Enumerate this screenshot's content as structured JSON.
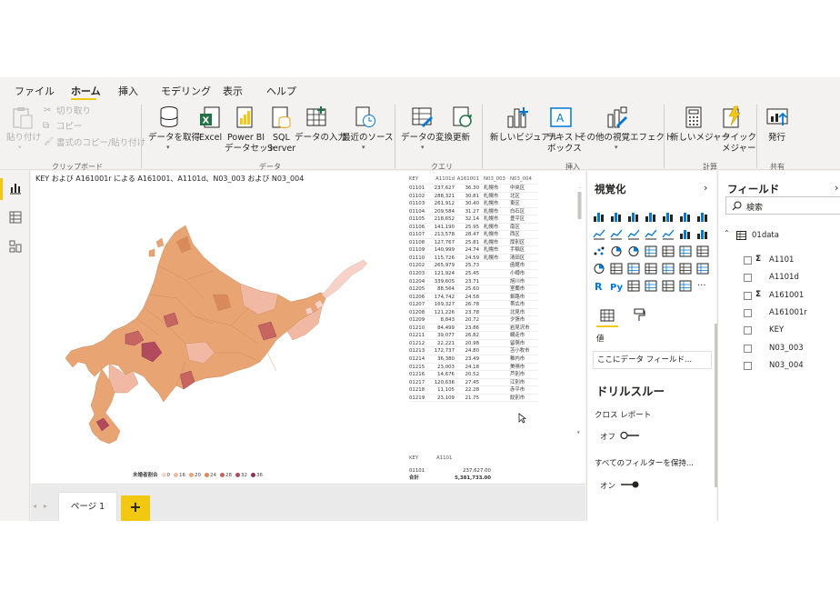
{
  "menu": {
    "file": "ファイル",
    "home": "ホーム",
    "insert": "挿入",
    "modeling": "モデリング",
    "view": "表示",
    "help": "ヘルプ"
  },
  "ribbon": {
    "clipboard": {
      "paste": "貼り付け",
      "cut": "切り取り",
      "copy": "コピー",
      "format_painter": "書式のコピー/貼り付け",
      "group": "クリップボード"
    },
    "data": {
      "get_data": "データを取得",
      "excel": "Excel",
      "pbi_line1": "Power BI",
      "pbi_line2": "データセット",
      "sql_line1": "SQL",
      "sql_line2": "Server",
      "enter_data": "データの入力",
      "recent_sources": "最近のソース",
      "group": "データ"
    },
    "queries": {
      "transform": "データの変換",
      "refresh": "更新",
      "group": "クエリ"
    },
    "insert": {
      "new_visual": "新しいビジュアル",
      "textbox_line1": "テキスト",
      "textbox_line2": "ボックス",
      "more_visuals": "その他の視覚エフェクト",
      "group": "挿入"
    },
    "calc": {
      "new_measure": "新しいメジャー",
      "quick_line1": "クイック",
      "quick_line2": "メジャー",
      "group": "計算"
    },
    "share": {
      "publish": "発行",
      "group": "共有"
    }
  },
  "visual": {
    "title": "KEY および A161001r による A161001、A1101d、N03_003 および N03_004",
    "legend_title": "未婚者割合",
    "legend": [
      {
        "label": "0",
        "color": "#f6d2c9"
      },
      {
        "label": "16",
        "color": "#f1b9a4"
      },
      {
        "label": "20",
        "color": "#e8a473"
      },
      {
        "label": "24",
        "color": "#d98a5a"
      },
      {
        "label": "28",
        "color": "#c76660"
      },
      {
        "label": "32",
        "color": "#b14a5c"
      },
      {
        "label": "36",
        "color": "#8f2f55"
      }
    ]
  },
  "table": {
    "headers": [
      "KEY",
      "A1101d",
      "A161001",
      "N03_003",
      "N03_004"
    ],
    "rows": [
      [
        "01101",
        "237,627",
        "36.30",
        "札幌市",
        "中央区"
      ],
      [
        "01102",
        "288,321",
        "30.81",
        "札幌市",
        "北区"
      ],
      [
        "01103",
        "261,912",
        "30.40",
        "札幌市",
        "東区"
      ],
      [
        "01104",
        "209,584",
        "31.27",
        "札幌市",
        "白石区"
      ],
      [
        "01105",
        "218,652",
        "32.14",
        "札幌市",
        "豊平区"
      ],
      [
        "01106",
        "141,190",
        "25.95",
        "札幌市",
        "南区"
      ],
      [
        "01107",
        "213,578",
        "28.47",
        "札幌市",
        "西区"
      ],
      [
        "01108",
        "127,767",
        "25.81",
        "札幌市",
        "厚別区"
      ],
      [
        "01109",
        "140,999",
        "24.74",
        "札幌市",
        "手稲区"
      ],
      [
        "01110",
        "115,726",
        "24.59",
        "札幌市",
        "清田区"
      ],
      [
        "01202",
        "265,979",
        "25.73",
        "",
        "函館市"
      ],
      [
        "01203",
        "121,924",
        "25.45",
        "",
        "小樽市"
      ],
      [
        "01204",
        "339,605",
        "23.71",
        "",
        "旭川市"
      ],
      [
        "01205",
        "88,564",
        "25.60",
        "",
        "室蘭市"
      ],
      [
        "01206",
        "174,742",
        "24.58",
        "",
        "釧路市"
      ],
      [
        "01207",
        "169,327",
        "26.78",
        "",
        "帯広市"
      ],
      [
        "01208",
        "121,226",
        "23.78",
        "",
        "北見市"
      ],
      [
        "01209",
        "8,843",
        "20.72",
        "",
        "夕張市"
      ],
      [
        "01210",
        "84,499",
        "23.86",
        "",
        "岩見沢市"
      ],
      [
        "01211",
        "39,077",
        "26.82",
        "",
        "網走市"
      ],
      [
        "01212",
        "22,221",
        "20.98",
        "",
        "留萌市"
      ],
      [
        "01213",
        "172,737",
        "24.80",
        "",
        "苫小牧市"
      ],
      [
        "01214",
        "36,380",
        "23.49",
        "",
        "稚内市"
      ],
      [
        "01215",
        "23,003",
        "24.18",
        "",
        "美唄市"
      ],
      [
        "01216",
        "14,676",
        "20.52",
        "",
        "芦別市"
      ],
      [
        "01217",
        "120,636",
        "27.45",
        "",
        "江別市"
      ],
      [
        "01218",
        "11,105",
        "22.28",
        "",
        "赤平市"
      ],
      [
        "01219",
        "23,109",
        "21.75",
        "",
        "紋別市"
      ]
    ],
    "total_table": {
      "headers": [
        "KEY",
        "A1101"
      ],
      "row": [
        "01101",
        "237,627.00"
      ],
      "total": [
        "合計",
        "5,381,733.00"
      ]
    }
  },
  "page_tab": "ページ 1",
  "add_page": "+",
  "viz_pane": {
    "title": "視覚化",
    "values_label": "値",
    "drop_placeholder": "ここにデータ フィールド...",
    "drillthrough": "ドリルスルー",
    "cross_report": "クロス レポート",
    "off": "オフ",
    "keep_filters": "すべてのフィルターを保持...",
    "on": "オン"
  },
  "fields_pane": {
    "title": "フィールド",
    "search_placeholder": "検索",
    "table_name": "01data",
    "fields": [
      {
        "name": "A1101",
        "sigma": "Σ"
      },
      {
        "name": "A1101d",
        "sigma": ""
      },
      {
        "name": "A161001",
        "sigma": "Σ"
      },
      {
        "name": "A161001r",
        "sigma": ""
      },
      {
        "name": "KEY",
        "sigma": ""
      },
      {
        "name": "N03_003",
        "sigma": ""
      },
      {
        "name": "N03_004",
        "sigma": ""
      }
    ]
  },
  "colors": {
    "accent": "#f2c811"
  }
}
